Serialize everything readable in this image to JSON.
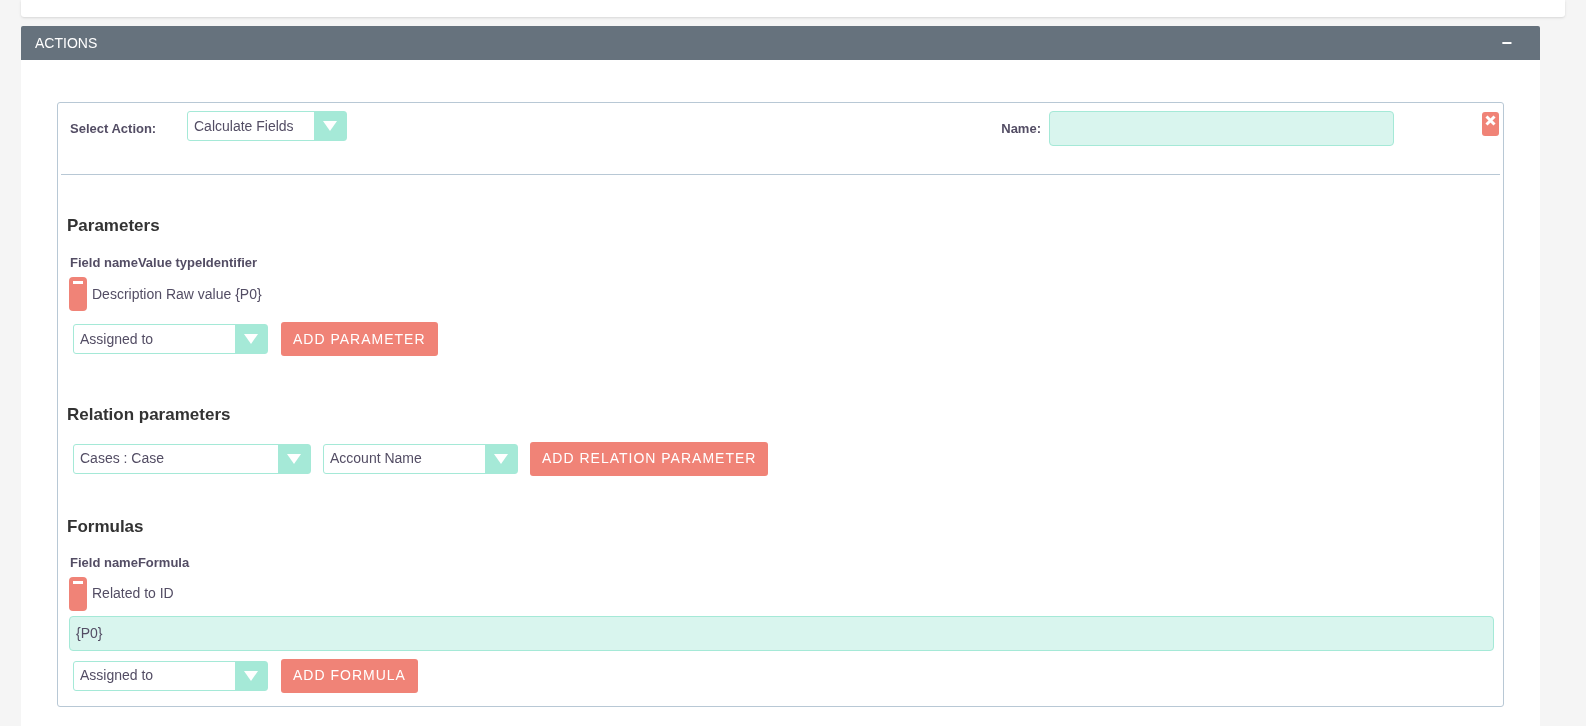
{
  "panel": {
    "title": "ACTIONS",
    "collapse_symbol": "−"
  },
  "action": {
    "select_label": "Select Action:",
    "select_value": "Calculate Fields",
    "name_label": "Name:"
  },
  "parameters": {
    "heading": "Parameters",
    "columns_header": "Field nameValue typeIdentifier",
    "rows": [
      {
        "text": "Description Raw value {P0}"
      }
    ],
    "field_select": "Assigned to",
    "add_button": "ADD PARAMETER"
  },
  "relation_parameters": {
    "heading": "Relation parameters",
    "module_select": "Cases : Case",
    "field_select": "Account Name",
    "add_button": "ADD RELATION PARAMETER"
  },
  "formulas": {
    "heading": "Formulas",
    "columns_header": "Field nameFormula",
    "rows": [
      {
        "field": "Related to ID",
        "formula": "{P0}"
      }
    ],
    "field_select": "Assigned to",
    "add_button": "ADD FORMULA"
  }
}
